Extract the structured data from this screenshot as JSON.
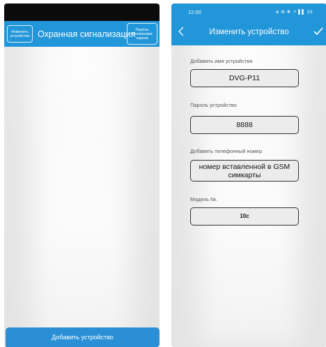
{
  "left_screen": {
    "edit_device_button": "Изменить\nустройство",
    "title": "Охранная сигнализация",
    "lock_password_button": "Пароль\nблокировки\nэкрана",
    "add_device_button": "Добавить устройство"
  },
  "right_screen": {
    "status_bar": {
      "time": "12:00",
      "icons_text": "⧈ ⚙ ✻ ↗ ▌▌ 33"
    },
    "title": "Изменить устройство",
    "fields": [
      {
        "label": "Добавить имя устройства",
        "value": "DVG-P11"
      },
      {
        "label": "Пароль устройство",
        "value": "8888"
      },
      {
        "label": "Добавить телефонный номер",
        "value": "номер вставленной в GSM симкарты"
      },
      {
        "label": "Модель №.",
        "value": "10c"
      }
    ]
  },
  "colors": {
    "header": "#2196d9",
    "add_button": "#2a8fd5",
    "background": "#e6e6e6"
  },
  "icons": [
    "back-icon",
    "check-icon"
  ]
}
